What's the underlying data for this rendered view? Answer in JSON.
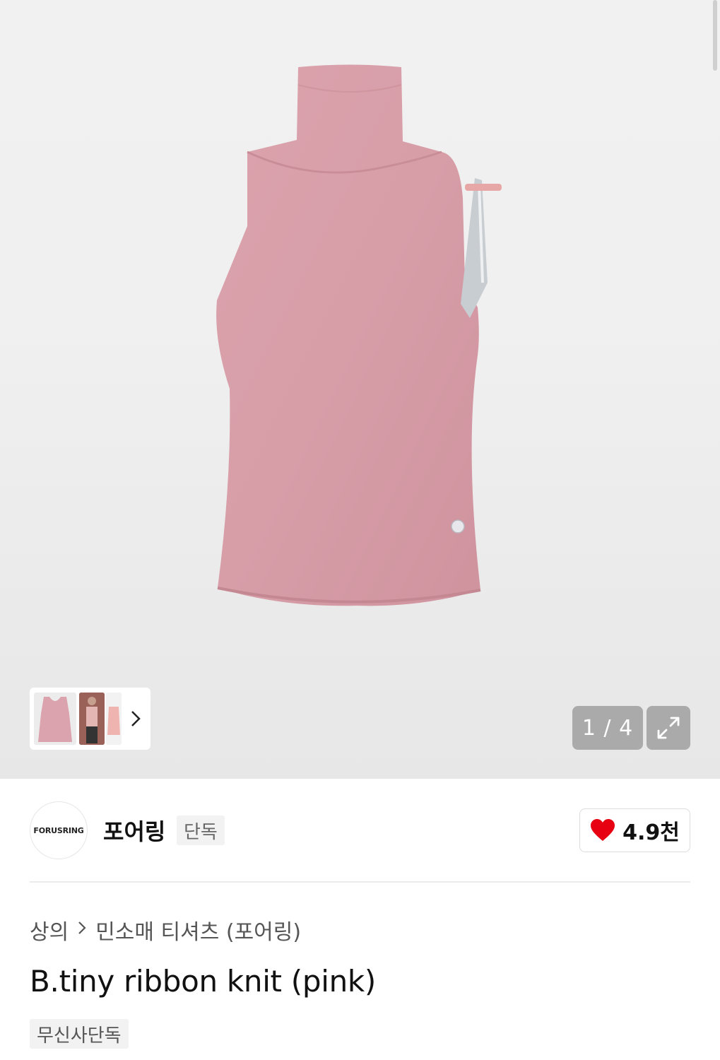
{
  "gallery": {
    "page_current": "1",
    "page_total": "4",
    "page_counter_text": "1 / 4",
    "next_icon": "chevron-right-icon",
    "expand_icon": "expand-icon",
    "accent_color": "#d9a0aa"
  },
  "brand": {
    "logo_text": "FORUSRING",
    "name": "포어링",
    "badge": "단독",
    "like_icon": "heart-icon",
    "like_color": "#e60012",
    "like_count": "4.9천"
  },
  "breadcrumb": {
    "category": "상의",
    "separator_icon": "chevron-right-icon",
    "subcategory": "민소매 티셔츠 (포어링)"
  },
  "product": {
    "title": "B.tiny ribbon knit (pink)",
    "tag": "무신사단독"
  }
}
